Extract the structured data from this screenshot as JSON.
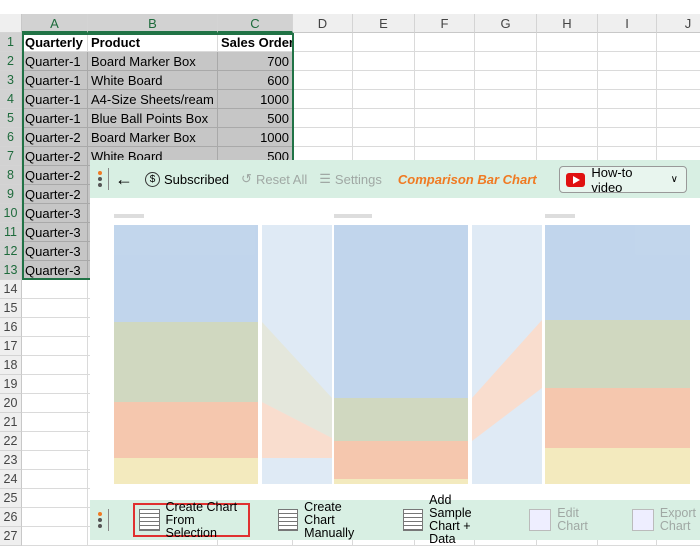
{
  "columns": [
    "A",
    "B",
    "C",
    "D",
    "E",
    "F",
    "G",
    "H",
    "I",
    "J"
  ],
  "rows": [
    [
      "Quarterly",
      "Product",
      "Sales Order"
    ],
    [
      "Quarter-1",
      "Board Marker Box",
      "700"
    ],
    [
      "Quarter-1",
      "White Board",
      "600"
    ],
    [
      "Quarter-1",
      "A4-Size Sheets/ream",
      "1000"
    ],
    [
      "Quarter-1",
      "Blue Ball Points Box",
      "500"
    ],
    [
      "Quarter-2",
      "Board Marker Box",
      "1000"
    ],
    [
      "Quarter-2",
      "White Board",
      "500"
    ],
    [
      "Quarter-2",
      "",
      ""
    ],
    [
      "Quarter-2",
      "",
      ""
    ],
    [
      "Quarter-3",
      "",
      ""
    ],
    [
      "Quarter-3",
      "",
      ""
    ],
    [
      "Quarter-3",
      "",
      ""
    ],
    [
      "Quarter-3",
      "",
      ""
    ]
  ],
  "row_numbers": [
    "1",
    "2",
    "3",
    "4",
    "5",
    "6",
    "7",
    "8",
    "9",
    "10",
    "11",
    "12",
    "13",
    "14",
    "15",
    "16",
    "17",
    "18",
    "19",
    "20",
    "21",
    "22",
    "23",
    "24",
    "25",
    "26",
    "27"
  ],
  "toolbar": {
    "subscribed": "Subscribed",
    "reset": "Reset All",
    "settings": "Settings",
    "title": "Comparison Bar Chart",
    "howto": "How-to video"
  },
  "bottom": {
    "create_sel": [
      "Create Chart",
      "From Selection"
    ],
    "create_man": [
      "Create Chart",
      "Manually"
    ],
    "sample": [
      "Add Sample",
      "Chart + Data"
    ],
    "edit": [
      "Edit",
      "Chart"
    ],
    "export": [
      "Export",
      "Chart"
    ]
  },
  "colors": {
    "accent": "#f07a22",
    "bar_bg": "#d8efe3",
    "selection": "#217346"
  }
}
